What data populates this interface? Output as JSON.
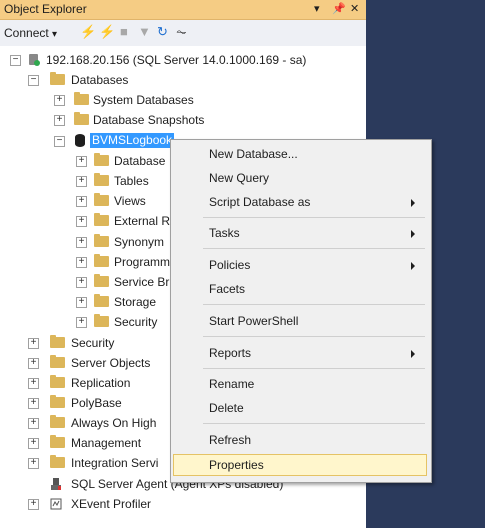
{
  "window": {
    "title": "Object Explorer",
    "controls": [
      "▾",
      "ᵖ",
      "✕"
    ]
  },
  "toolbar": {
    "connect_label": "Connect",
    "connect_arrow": "▾"
  },
  "tree": {
    "server": "192.168.20.156 (SQL Server 14.0.1000.169 - sa)",
    "databases": "Databases",
    "system_databases": "System Databases",
    "database_snapshots": "Database Snapshots",
    "bvms_db": "BVMSLogbook",
    "db_children": [
      "Database",
      "Tables",
      "Views",
      "External R",
      "Synonym",
      "Programm",
      "Service Br",
      "Storage",
      "Security"
    ],
    "server_children": [
      "Security",
      "Server Objects",
      "Replication",
      "PolyBase",
      "Always On High",
      "Management",
      "Integration Servi"
    ],
    "sql_agent": "SQL Server Agent (Agent XPs disabled)",
    "xevent": "XEvent Profiler"
  },
  "context_menu": {
    "items": [
      {
        "label": "New Database...",
        "submenu": false
      },
      {
        "label": "New Query",
        "submenu": false
      },
      {
        "label": "Script Database as",
        "submenu": true
      },
      {
        "label": "Tasks",
        "submenu": true
      },
      {
        "label": "Policies",
        "submenu": true
      },
      {
        "label": "Facets",
        "submenu": false
      },
      {
        "label": "Start PowerShell",
        "submenu": false
      },
      {
        "label": "Reports",
        "submenu": true
      },
      {
        "label": "Rename",
        "submenu": false
      },
      {
        "label": "Delete",
        "submenu": false
      },
      {
        "label": "Refresh",
        "submenu": false
      },
      {
        "label": "Properties",
        "submenu": false,
        "highlighted": true
      }
    ]
  },
  "colors": {
    "titlebar": "#f5cc84",
    "selection": "#3399ff",
    "menu_highlight": "#fff6cc",
    "folder": "#dcb65a",
    "background": "#2b3a5c"
  }
}
